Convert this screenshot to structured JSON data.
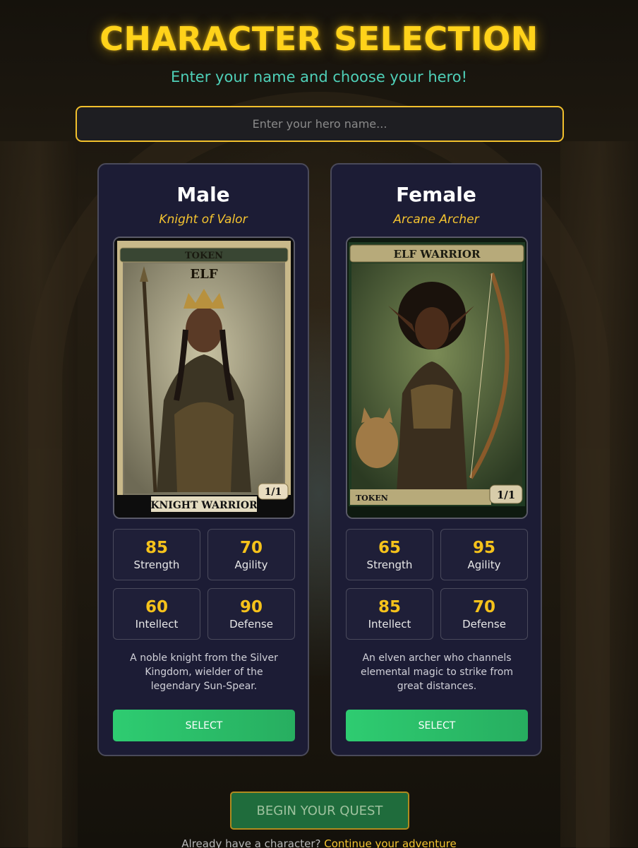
{
  "header": {
    "title": "CHARACTER SELECTION",
    "subtitle": "Enter your name and choose your hero!"
  },
  "name_input": {
    "placeholder": "Enter your hero name...",
    "value": ""
  },
  "characters": [
    {
      "name": "Male",
      "class": "Knight of Valor",
      "card": {
        "top_label": "TOKEN",
        "type": "ELF",
        "bottom_label": "KNIGHT WARRIOR",
        "pt": "1/1"
      },
      "stats": [
        {
          "value": "85",
          "label": "Strength"
        },
        {
          "value": "70",
          "label": "Agility"
        },
        {
          "value": "60",
          "label": "Intellect"
        },
        {
          "value": "90",
          "label": "Defense"
        }
      ],
      "description": "A noble knight from the Silver Kingdom, wielder of the legendary Sun-Spear.",
      "select_label": "SELECT"
    },
    {
      "name": "Female",
      "class": "Arcane Archer",
      "card": {
        "top_label": "ELF WARRIOR",
        "bottom_label": "TOKEN",
        "pt": "1/1"
      },
      "stats": [
        {
          "value": "65",
          "label": "Strength"
        },
        {
          "value": "95",
          "label": "Agility"
        },
        {
          "value": "85",
          "label": "Intellect"
        },
        {
          "value": "70",
          "label": "Defense"
        }
      ],
      "description": "An elven archer who channels elemental magic to strike from great distances.",
      "select_label": "SELECT"
    }
  ],
  "begin_button": "BEGIN YOUR QUEST",
  "footer": {
    "text": "Already have a character?",
    "link": "Continue your adventure"
  },
  "colors": {
    "accent_gold": "#ffd21a",
    "subtitle_teal": "#4fd0b8",
    "select_green": "#2ecc71"
  }
}
